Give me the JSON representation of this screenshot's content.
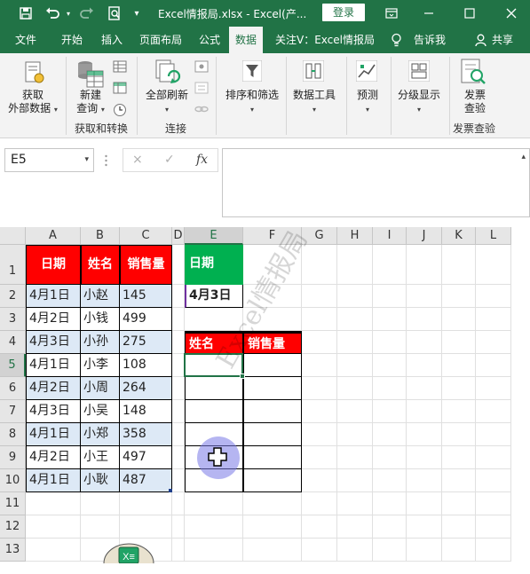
{
  "titlebar": {
    "title": "Excel情报局.xlsx  -  Excel(产...",
    "login_label": "登录",
    "icons": [
      "save-icon",
      "undo-icon",
      "redo-icon",
      "print-preview-icon",
      "customize-icon",
      "ribbon-display-icon",
      "minimize-icon",
      "maximize-icon",
      "close-icon"
    ]
  },
  "tabs": [
    "文件",
    "开始",
    "插入",
    "页面布局",
    "公式",
    "数据",
    "关注V：Excel情报局",
    "告诉我",
    "共享"
  ],
  "active_tab": "数据",
  "ribbon": {
    "get_data": [
      "获取",
      "外部数据"
    ],
    "new_query": [
      "新建",
      "查询"
    ],
    "group_get_transform": "获取和转换",
    "refresh_all": "全部刷新",
    "group_connections": "连接",
    "sort_filter": "排序和筛选",
    "data_tools": "数据工具",
    "forecast": "预测",
    "outline": "分级显示",
    "inquire": [
      "发票",
      "查验"
    ],
    "group_inquire": "发票查验"
  },
  "formula_bar": {
    "name_box": "E5",
    "cancel_icon": "×",
    "enter_icon": "✓",
    "fx_label": "fx",
    "formula": ""
  },
  "columns": [
    "A",
    "B",
    "C",
    "D",
    "E",
    "F",
    "G",
    "H",
    "I",
    "J",
    "K",
    "L"
  ],
  "rows": [
    "1",
    "2",
    "3",
    "4",
    "5",
    "6",
    "7",
    "8",
    "9",
    "10",
    "11",
    "12",
    "13"
  ],
  "selected_cell": "E5",
  "table": {
    "headers": [
      "日期",
      "姓名",
      "销售量"
    ],
    "rows": [
      [
        "4月1日",
        "小赵",
        "145"
      ],
      [
        "4月2日",
        "小钱",
        "499"
      ],
      [
        "4月3日",
        "小孙",
        "275"
      ],
      [
        "4月1日",
        "小李",
        "108"
      ],
      [
        "4月2日",
        "小周",
        "264"
      ],
      [
        "4月3日",
        "小吴",
        "148"
      ],
      [
        "4月1日",
        "小郑",
        "358"
      ],
      [
        "4月2日",
        "小王",
        "497"
      ],
      [
        "4月1日",
        "小耿",
        "487"
      ]
    ]
  },
  "criteria": {
    "header": "日期",
    "value": "4月3日"
  },
  "output": {
    "headers": [
      "姓名",
      "销售量"
    ]
  },
  "watermark": "Excel情报局",
  "colors": {
    "excel_green": "#217346",
    "header_red": "#ff0000",
    "header_green": "#00b050",
    "band_blue": "#dde9f6"
  }
}
